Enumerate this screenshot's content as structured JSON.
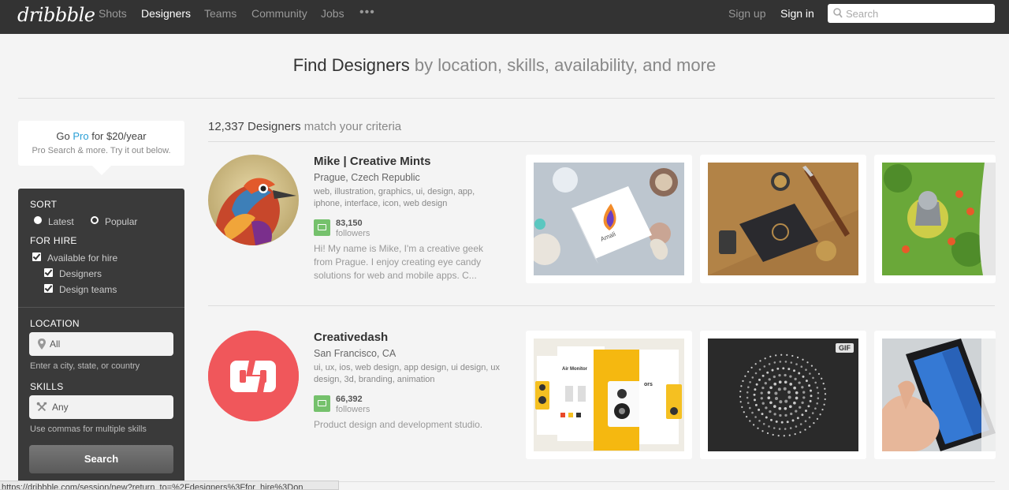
{
  "nav": {
    "logo": "dribbble",
    "items": [
      {
        "label": "Shots",
        "active": false
      },
      {
        "label": "Designers",
        "active": true
      },
      {
        "label": "Teams",
        "active": false
      },
      {
        "label": "Community",
        "active": false
      },
      {
        "label": "Jobs",
        "active": false
      }
    ],
    "more_label": "•••",
    "signup": "Sign up",
    "signin": "Sign in",
    "search_placeholder": "Search"
  },
  "hero": {
    "strong": "Find Designers",
    "rest": " by location, skills, availability, and more"
  },
  "pro": {
    "go": "Go ",
    "pro_word": "Pro",
    "price": " for $20/year",
    "subtitle": "Pro Search & more. Try it out below."
  },
  "filters": {
    "sort_heading": "SORT",
    "sort_latest": "Latest",
    "sort_popular": "Popular",
    "sort_selected": "Popular",
    "hire_heading": "FOR HIRE",
    "available": "Available for hire",
    "designers": "Designers",
    "design_teams": "Design teams",
    "location_heading": "LOCATION",
    "location_value": "All",
    "location_hint": "Enter a city, state, or country",
    "skills_heading": "SKILLS",
    "skills_value": "Any",
    "skills_hint": "Use commas for multiple skills",
    "search_button": "Search"
  },
  "results": {
    "count": "12,337 Designers",
    "suffix": " match your criteria"
  },
  "designers": [
    {
      "name": "Mike | Creative Mints",
      "location": "Prague, Czech Republic",
      "skills": "web, illustration, graphics, ui, design, app, iphone, interface, icon, web design",
      "followers": "83,150",
      "followers_label": "followers",
      "bio": "Hi! My name is Mike, I'm a creative geek from Prague. I enjoy creating eye candy solutions for web and mobile apps. C..."
    },
    {
      "name": "Creativedash",
      "location": "San Francisco, CA",
      "skills": "ui, ux, ios, web design, app design, ui design, ux design, 3d, branding, animation",
      "followers": "66,392",
      "followers_label": "followers",
      "bio": "Product design and development studio.",
      "gif_badge": "GIF"
    }
  ],
  "shot_images": {
    "amali_label": "Amali",
    "speaker_title": "Air Monitor",
    "speaker_side": "ors"
  },
  "status_url": "https://dribbble.com/session/new?return_to=%2Fdesigners%3Ffor_hire%3Don"
}
